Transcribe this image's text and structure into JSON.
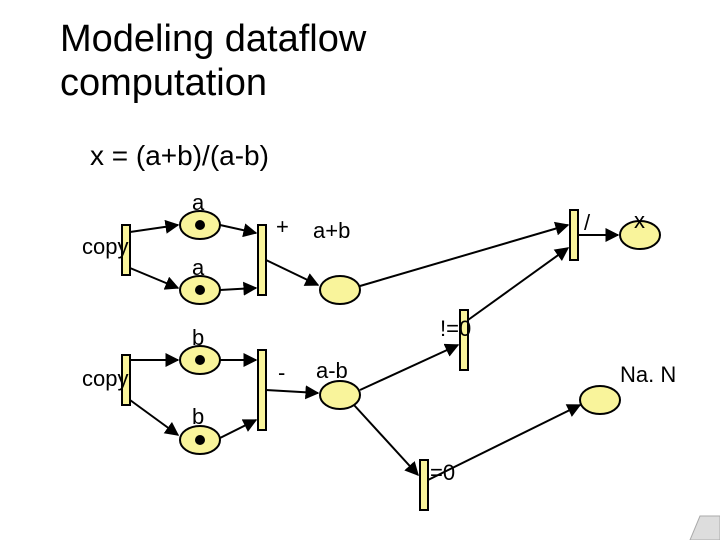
{
  "title_line1": "Modeling dataflow",
  "title_line2": "computation",
  "expression": "x = (a+b)/(a-b)",
  "labels": {
    "copy1": "copy",
    "copy2": "copy",
    "a1": "a",
    "a2": "a",
    "b1": "b",
    "b2": "b",
    "plus": "+",
    "minus": "-",
    "aplusb": "a+b",
    "aminusb": "a-b",
    "neq0": "!=0",
    "eq0": "=0",
    "div": "/",
    "x": "x",
    "nan": "Na. N"
  },
  "colors": {
    "node_fill": "#F9F49B",
    "stroke": "#000"
  }
}
